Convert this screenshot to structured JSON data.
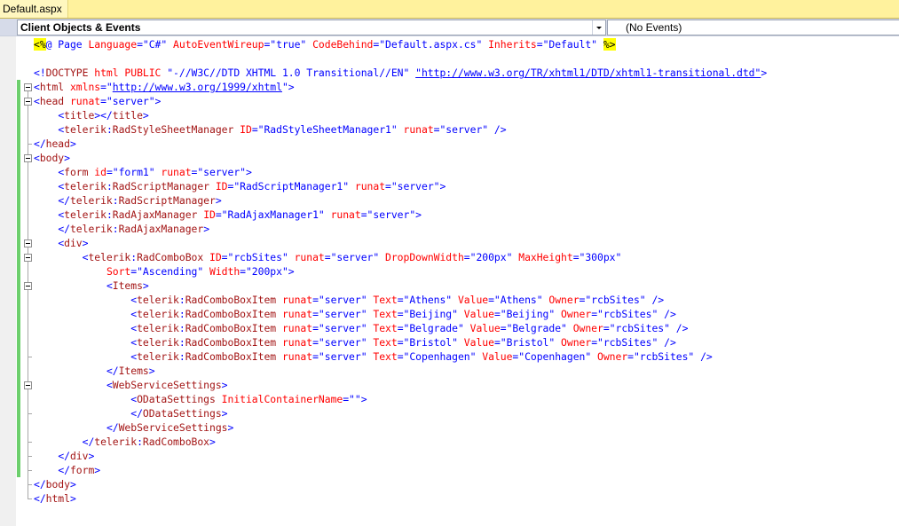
{
  "tab": {
    "title": "Default.aspx"
  },
  "nav": {
    "objects_label": "Client Objects & Events",
    "events_label": "(No Events)"
  },
  "editor": {
    "lines": [
      [
        [
          "hl",
          "<%"
        ],
        [
          "b",
          "@ Page "
        ],
        [
          "r",
          "Language"
        ],
        [
          "b",
          "="
        ],
        [
          "b",
          "\"C#\" "
        ],
        [
          "r",
          "AutoEventWireup"
        ],
        [
          "b",
          "="
        ],
        [
          "b",
          "\"true\" "
        ],
        [
          "r",
          "CodeBehind"
        ],
        [
          "b",
          "="
        ],
        [
          "b",
          "\"Default.aspx.cs\" "
        ],
        [
          "r",
          "Inherits"
        ],
        [
          "b",
          "="
        ],
        [
          "b",
          "\"Default\" "
        ],
        [
          "hl",
          "%>"
        ]
      ],
      [],
      [
        [
          "b",
          "<!"
        ],
        [
          "m",
          "DOCTYPE "
        ],
        [
          "r",
          "html "
        ],
        [
          "r",
          "PUBLIC "
        ],
        [
          "b",
          "\"-//W3C//DTD XHTML 1.0 Transitional//EN\" "
        ],
        [
          "u",
          "\"http://www.w3.org/TR/xhtml1/DTD/xhtml1-transitional.dtd\""
        ],
        [
          "b",
          ">"
        ]
      ],
      [
        [
          "b",
          "<"
        ],
        [
          "m",
          "html "
        ],
        [
          "r",
          "xmlns"
        ],
        [
          "b",
          "=\""
        ],
        [
          "u",
          "http://www.w3.org/1999/xhtml"
        ],
        [
          "b",
          "\">"
        ]
      ],
      [
        [
          "b",
          "<"
        ],
        [
          "m",
          "head "
        ],
        [
          "r",
          "runat"
        ],
        [
          "b",
          "=\"server\">"
        ]
      ],
      [
        [
          "k",
          "    "
        ],
        [
          "b",
          "<"
        ],
        [
          "m",
          "title"
        ],
        [
          "b",
          "></"
        ],
        [
          "m",
          "title"
        ],
        [
          "b",
          ">"
        ]
      ],
      [
        [
          "k",
          "    "
        ],
        [
          "b",
          "<"
        ],
        [
          "m",
          "telerik"
        ],
        [
          "b",
          ":"
        ],
        [
          "m",
          "RadStyleSheetManager "
        ],
        [
          "r",
          "ID"
        ],
        [
          "b",
          "=\"RadStyleSheetManager1\" "
        ],
        [
          "r",
          "runat"
        ],
        [
          "b",
          "=\"server\" />"
        ]
      ],
      [
        [
          "b",
          "</"
        ],
        [
          "m",
          "head"
        ],
        [
          "b",
          ">"
        ]
      ],
      [
        [
          "b",
          "<"
        ],
        [
          "m",
          "body"
        ],
        [
          "b",
          ">"
        ]
      ],
      [
        [
          "k",
          "    "
        ],
        [
          "b",
          "<"
        ],
        [
          "m",
          "form "
        ],
        [
          "r",
          "id"
        ],
        [
          "b",
          "=\"form1\" "
        ],
        [
          "r",
          "runat"
        ],
        [
          "b",
          "=\"server\">"
        ]
      ],
      [
        [
          "k",
          "    "
        ],
        [
          "b",
          "<"
        ],
        [
          "m",
          "telerik"
        ],
        [
          "b",
          ":"
        ],
        [
          "m",
          "RadScriptManager "
        ],
        [
          "r",
          "ID"
        ],
        [
          "b",
          "=\"RadScriptManager1\" "
        ],
        [
          "r",
          "runat"
        ],
        [
          "b",
          "=\"server\">"
        ]
      ],
      [
        [
          "k",
          "    "
        ],
        [
          "b",
          "</"
        ],
        [
          "m",
          "telerik"
        ],
        [
          "b",
          ":"
        ],
        [
          "m",
          "RadScriptManager"
        ],
        [
          "b",
          ">"
        ]
      ],
      [
        [
          "k",
          "    "
        ],
        [
          "b",
          "<"
        ],
        [
          "m",
          "telerik"
        ],
        [
          "b",
          ":"
        ],
        [
          "m",
          "RadAjaxManager "
        ],
        [
          "r",
          "ID"
        ],
        [
          "b",
          "=\"RadAjaxManager1\" "
        ],
        [
          "r",
          "runat"
        ],
        [
          "b",
          "=\"server\">"
        ]
      ],
      [
        [
          "k",
          "    "
        ],
        [
          "b",
          "</"
        ],
        [
          "m",
          "telerik"
        ],
        [
          "b",
          ":"
        ],
        [
          "m",
          "RadAjaxManager"
        ],
        [
          "b",
          ">"
        ]
      ],
      [
        [
          "k",
          "    "
        ],
        [
          "b",
          "<"
        ],
        [
          "m",
          "div"
        ],
        [
          "b",
          ">"
        ]
      ],
      [
        [
          "k",
          "        "
        ],
        [
          "b",
          "<"
        ],
        [
          "m",
          "telerik"
        ],
        [
          "b",
          ":"
        ],
        [
          "m",
          "RadComboBox "
        ],
        [
          "r",
          "ID"
        ],
        [
          "b",
          "=\"rcbSites\" "
        ],
        [
          "r",
          "runat"
        ],
        [
          "b",
          "=\"server\" "
        ],
        [
          "r",
          "DropDownWidth"
        ],
        [
          "b",
          "=\"200px\" "
        ],
        [
          "r",
          "MaxHeight"
        ],
        [
          "b",
          "=\"300px\""
        ]
      ],
      [
        [
          "k",
          "            "
        ],
        [
          "r",
          "Sort"
        ],
        [
          "b",
          "=\"Ascending\" "
        ],
        [
          "r",
          "Width"
        ],
        [
          "b",
          "=\"200px\">"
        ]
      ],
      [
        [
          "k",
          "            "
        ],
        [
          "b",
          "<"
        ],
        [
          "m",
          "Items"
        ],
        [
          "b",
          ">"
        ]
      ],
      [
        [
          "k",
          "                "
        ],
        [
          "b",
          "<"
        ],
        [
          "m",
          "telerik"
        ],
        [
          "b",
          ":"
        ],
        [
          "m",
          "RadComboBoxItem "
        ],
        [
          "r",
          "runat"
        ],
        [
          "b",
          "=\"server\" "
        ],
        [
          "r",
          "Text"
        ],
        [
          "b",
          "=\"Athens\" "
        ],
        [
          "r",
          "Value"
        ],
        [
          "b",
          "=\"Athens\" "
        ],
        [
          "r",
          "Owner"
        ],
        [
          "b",
          "=\"rcbSites\" />"
        ]
      ],
      [
        [
          "k",
          "                "
        ],
        [
          "b",
          "<"
        ],
        [
          "m",
          "telerik"
        ],
        [
          "b",
          ":"
        ],
        [
          "m",
          "RadComboBoxItem "
        ],
        [
          "r",
          "runat"
        ],
        [
          "b",
          "=\"server\" "
        ],
        [
          "r",
          "Text"
        ],
        [
          "b",
          "=\"Beijing\" "
        ],
        [
          "r",
          "Value"
        ],
        [
          "b",
          "=\"Beijing\" "
        ],
        [
          "r",
          "Owner"
        ],
        [
          "b",
          "=\"rcbSites\" />"
        ]
      ],
      [
        [
          "k",
          "                "
        ],
        [
          "b",
          "<"
        ],
        [
          "m",
          "telerik"
        ],
        [
          "b",
          ":"
        ],
        [
          "m",
          "RadComboBoxItem "
        ],
        [
          "r",
          "runat"
        ],
        [
          "b",
          "=\"server\" "
        ],
        [
          "r",
          "Text"
        ],
        [
          "b",
          "=\"Belgrade\" "
        ],
        [
          "r",
          "Value"
        ],
        [
          "b",
          "=\"Belgrade\" "
        ],
        [
          "r",
          "Owner"
        ],
        [
          "b",
          "=\"rcbSites\" />"
        ]
      ],
      [
        [
          "k",
          "                "
        ],
        [
          "b",
          "<"
        ],
        [
          "m",
          "telerik"
        ],
        [
          "b",
          ":"
        ],
        [
          "m",
          "RadComboBoxItem "
        ],
        [
          "r",
          "runat"
        ],
        [
          "b",
          "=\"server\" "
        ],
        [
          "r",
          "Text"
        ],
        [
          "b",
          "=\"Bristol\" "
        ],
        [
          "r",
          "Value"
        ],
        [
          "b",
          "=\"Bristol\" "
        ],
        [
          "r",
          "Owner"
        ],
        [
          "b",
          "=\"rcbSites\" />"
        ]
      ],
      [
        [
          "k",
          "                "
        ],
        [
          "b",
          "<"
        ],
        [
          "m",
          "telerik"
        ],
        [
          "b",
          ":"
        ],
        [
          "m",
          "RadComboBoxItem "
        ],
        [
          "r",
          "runat"
        ],
        [
          "b",
          "=\"server\" "
        ],
        [
          "r",
          "Text"
        ],
        [
          "b",
          "=\"Copenhagen\" "
        ],
        [
          "r",
          "Value"
        ],
        [
          "b",
          "=\"Copenhagen\" "
        ],
        [
          "r",
          "Owner"
        ],
        [
          "b",
          "=\"rcbSites\" />"
        ]
      ],
      [
        [
          "k",
          "            "
        ],
        [
          "b",
          "</"
        ],
        [
          "m",
          "Items"
        ],
        [
          "b",
          ">"
        ]
      ],
      [
        [
          "k",
          "            "
        ],
        [
          "b",
          "<"
        ],
        [
          "m",
          "WebServiceSettings"
        ],
        [
          "b",
          ">"
        ]
      ],
      [
        [
          "k",
          "                "
        ],
        [
          "b",
          "<"
        ],
        [
          "m",
          "ODataSettings "
        ],
        [
          "r",
          "InitialContainerName"
        ],
        [
          "b",
          "=\"\">"
        ]
      ],
      [
        [
          "k",
          "                "
        ],
        [
          "b",
          "</"
        ],
        [
          "m",
          "ODataSettings"
        ],
        [
          "b",
          ">"
        ]
      ],
      [
        [
          "k",
          "            "
        ],
        [
          "b",
          "</"
        ],
        [
          "m",
          "WebServiceSettings"
        ],
        [
          "b",
          ">"
        ]
      ],
      [
        [
          "k",
          "        "
        ],
        [
          "b",
          "</"
        ],
        [
          "m",
          "telerik"
        ],
        [
          "b",
          ":"
        ],
        [
          "m",
          "RadComboBox"
        ],
        [
          "b",
          ">"
        ]
      ],
      [
        [
          "k",
          "    "
        ],
        [
          "b",
          "</"
        ],
        [
          "m",
          "div"
        ],
        [
          "b",
          ">"
        ]
      ],
      [
        [
          "k",
          "    "
        ],
        [
          "b",
          "</"
        ],
        [
          "m",
          "form"
        ],
        [
          "b",
          ">"
        ]
      ],
      [
        [
          "b",
          "</"
        ],
        [
          "m",
          "body"
        ],
        [
          "b",
          ">"
        ]
      ],
      [
        [
          "b",
          "</"
        ],
        [
          "m",
          "html"
        ],
        [
          "b",
          ">"
        ]
      ]
    ]
  }
}
